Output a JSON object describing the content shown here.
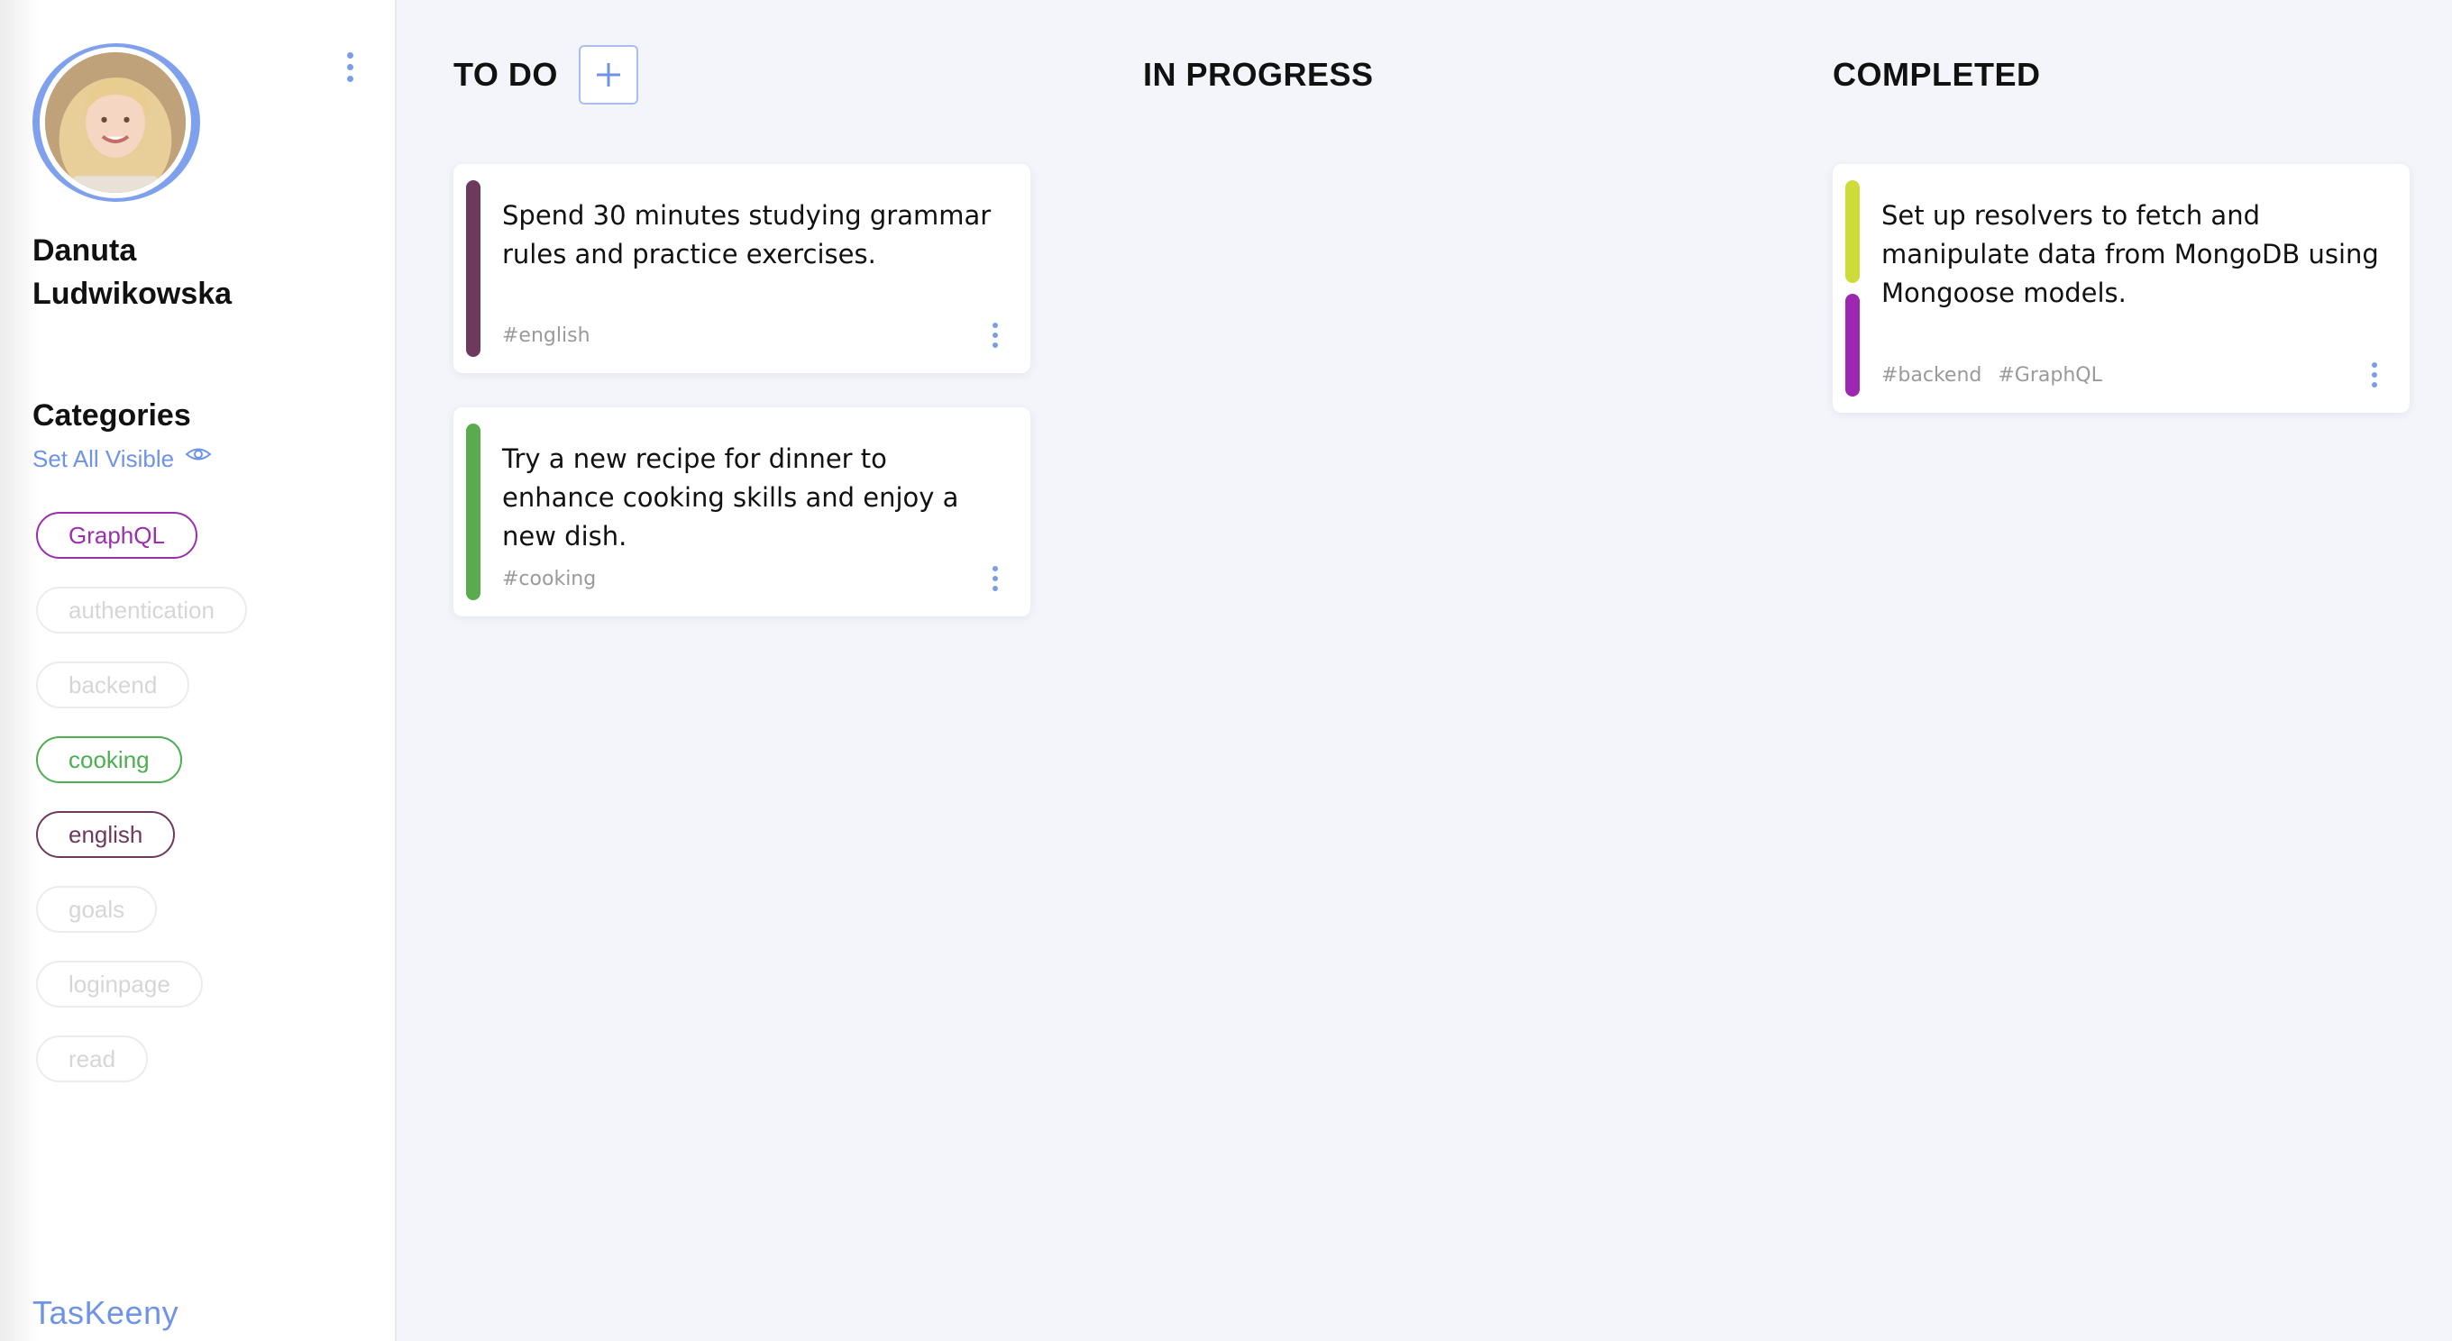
{
  "user": {
    "name": "Danuta Ludwikowska"
  },
  "sidebar": {
    "categories_title": "Categories",
    "set_all_visible": "Set All Visible",
    "brand": "TasKeeny",
    "categories": [
      {
        "label": "GraphQL",
        "visible": true,
        "color": "#9b2fae"
      },
      {
        "label": "authentication",
        "visible": false,
        "color": "#d8d8d8"
      },
      {
        "label": "backend",
        "visible": false,
        "color": "#d8d8d8"
      },
      {
        "label": "cooking",
        "visible": true,
        "color": "#4caf50"
      },
      {
        "label": "english",
        "visible": true,
        "color": "#6d3a5d"
      },
      {
        "label": "goals",
        "visible": false,
        "color": "#d8d8d8"
      },
      {
        "label": "loginpage",
        "visible": false,
        "color": "#d8d8d8"
      },
      {
        "label": "read",
        "visible": false,
        "color": "#d8d8d8"
      }
    ]
  },
  "columns": {
    "todo": {
      "title": "TO DO",
      "cards": [
        {
          "text": "Spend 30 minutes studying grammar rules and practice exercises.",
          "tags": [
            "#english"
          ],
          "colors": [
            "#6d3a5d"
          ]
        },
        {
          "text": "Try a new recipe for dinner to enhance cooking skills and enjoy a new dish.",
          "tags": [
            "#cooking"
          ],
          "colors": [
            "#5aaa4e"
          ]
        }
      ]
    },
    "in_progress": {
      "title": "IN PROGRESS",
      "cards": []
    },
    "completed": {
      "title": "COMPLETED",
      "cards": [
        {
          "text": "Set up resolvers to fetch and manipulate data from MongoDB using Mongoose models.",
          "tags": [
            "#backend",
            "#GraphQL"
          ],
          "colors": [
            "#cddc39",
            "#9c27b0"
          ]
        }
      ]
    }
  },
  "icons": {
    "profile_menu": "vertical-dots-icon",
    "set_visible": "eye-icon",
    "add_task": "plus-icon",
    "card_menu": "vertical-dots-icon"
  },
  "theme": {
    "accent": "#6f93e6",
    "background": "#f4f5fb"
  }
}
